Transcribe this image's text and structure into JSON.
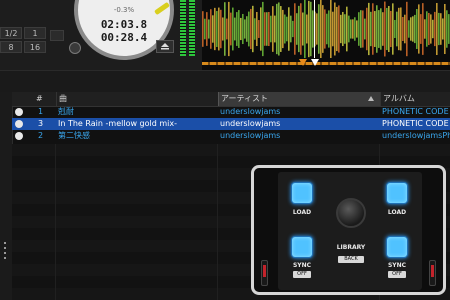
{
  "deck": {
    "loop_sizes": [
      "1/2",
      "1",
      "8",
      "16"
    ],
    "jog_pitch": "-0.3%",
    "elapsed_time": "02:03.8",
    "remaining_time": "00:28.4",
    "waveform_colors": [
      "#e0b23a",
      "#6fbf3b",
      "#d86f2b",
      "#d1cf43",
      "#8acb46"
    ]
  },
  "browser": {
    "columns": {
      "number": "#",
      "title": "曲",
      "artist": "アーティスト",
      "album": "アルバム"
    },
    "sorted_column": "artist",
    "sort_direction": "ascending",
    "tracks": [
      {
        "number": "1",
        "title": "剋耐",
        "artist": "underslowjams",
        "album": "PHONETIC CODE",
        "selected": false
      },
      {
        "number": "3",
        "title": "In The Rain -mellow gold mix-",
        "artist": "underslowjams",
        "album": "PHONETIC CODE",
        "selected": true
      },
      {
        "number": "2",
        "title": "第二快感",
        "artist": "underslowjams",
        "album": "underslowjamsPho",
        "selected": false
      }
    ]
  },
  "controller": {
    "load_left": "LOAD",
    "load_right": "LOAD",
    "library": "LIBRARY",
    "back": "BACK",
    "sync_left": "SYNC",
    "sync_right": "SYNC",
    "off_left": "OFF",
    "off_right": "OFF",
    "button_color": "#50c2ff"
  }
}
